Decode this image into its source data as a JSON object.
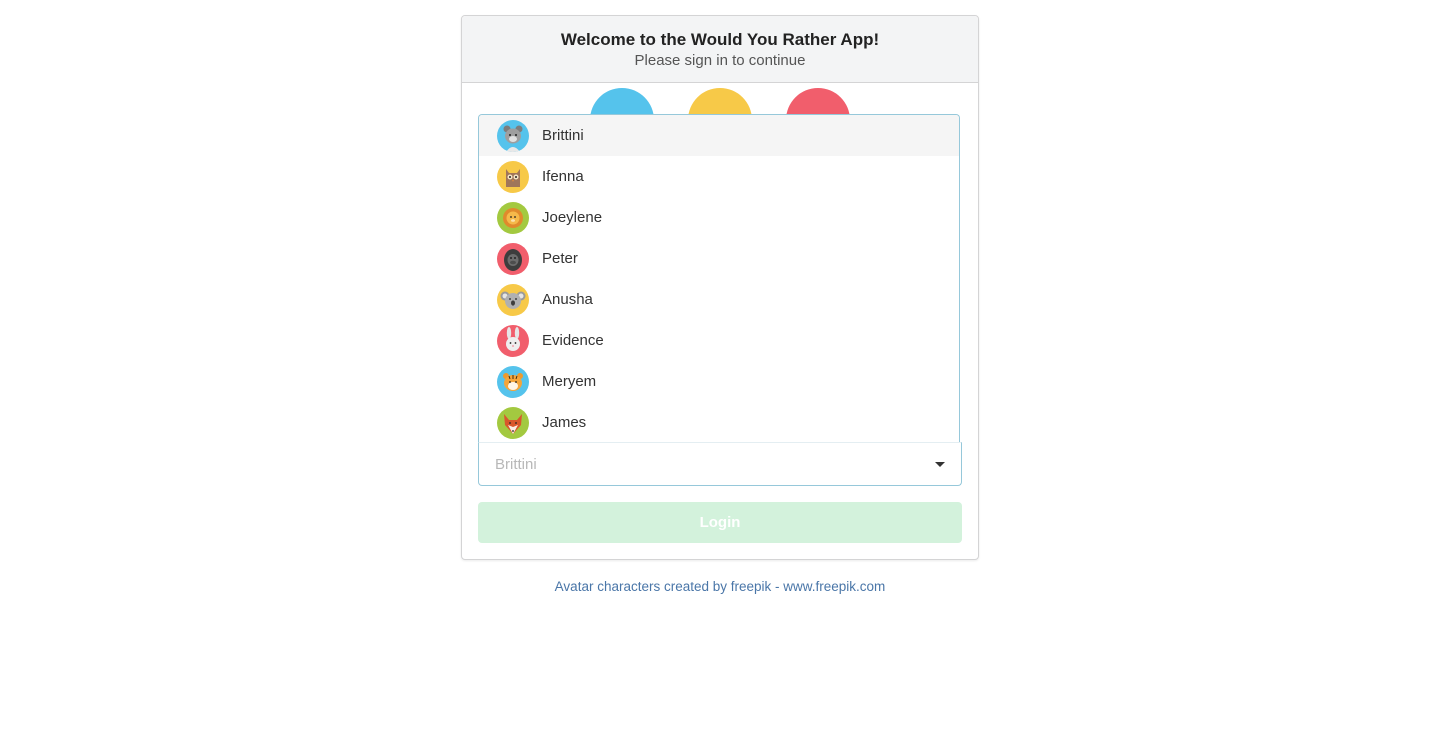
{
  "header": {
    "title": "Welcome to the Would You Rather App!",
    "subtitle": "Please sign in to continue"
  },
  "hero_circles": [
    {
      "color": "#55c3ec"
    },
    {
      "color": "#f7c948"
    },
    {
      "color": "#f15e6c"
    }
  ],
  "dropdown": {
    "items": [
      {
        "label": "Brittini",
        "avatar": "bear-icon",
        "bg": "#55c3ec"
      },
      {
        "label": "Ifenna",
        "avatar": "owl-icon",
        "bg": "#f7c948"
      },
      {
        "label": "Joeylene",
        "avatar": "lion-icon",
        "bg": "#a3c940"
      },
      {
        "label": "Peter",
        "avatar": "gorilla-icon",
        "bg": "#f15e6c"
      },
      {
        "label": "Anusha",
        "avatar": "koala-icon",
        "bg": "#f7c948"
      },
      {
        "label": "Evidence",
        "avatar": "rabbit-icon",
        "bg": "#f15e6c"
      },
      {
        "label": "Meryem",
        "avatar": "tiger-icon",
        "bg": "#55c3ec"
      },
      {
        "label": "James",
        "avatar": "fox-icon",
        "bg": "#a3c940"
      }
    ],
    "selected": "Brittini"
  },
  "login": {
    "label": "Login"
  },
  "footer": {
    "credit": "Avatar characters created by freepik - www.freepik.com"
  },
  "colors": {
    "accent_border": "#96c8da",
    "login_disabled": "#d3f2dc",
    "link": "#4a76a8"
  }
}
